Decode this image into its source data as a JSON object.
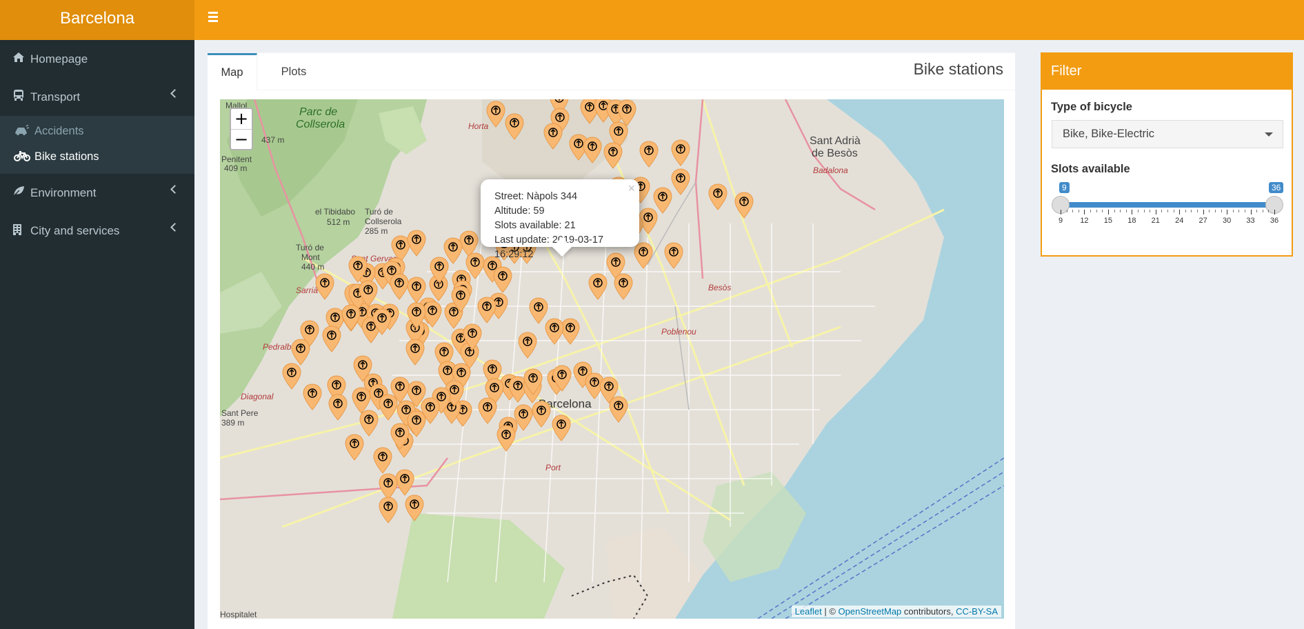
{
  "app": {
    "title": "Barcelona"
  },
  "sidebar": {
    "items": [
      {
        "label": "Homepage",
        "icon": "home-icon"
      },
      {
        "label": "Transport",
        "icon": "bus-icon"
      },
      {
        "label": "Environment",
        "icon": "leaf-icon"
      },
      {
        "label": "City and services",
        "icon": "building-icon"
      }
    ],
    "transport_sub": [
      {
        "label": "Accidents",
        "icon": "car-crash-icon"
      },
      {
        "label": "Bike stations",
        "icon": "bicycle-icon"
      }
    ]
  },
  "tabs": [
    {
      "label": "Map"
    },
    {
      "label": "Plots"
    }
  ],
  "box_title": "Bike stations",
  "map": {
    "zoom_in": "+",
    "zoom_out": "−",
    "labels": [
      {
        "text": "Parc de"
      },
      {
        "text": "Collserola"
      },
      {
        "text": "Horta"
      },
      {
        "text": "Sant Adrià"
      },
      {
        "text": "de Besòs"
      },
      {
        "text": "el Tibidabo"
      },
      {
        "text": "512 m"
      },
      {
        "text": "Turó de"
      },
      {
        "text": "Collserola"
      },
      {
        "text": "285 m"
      },
      {
        "text": "Turó de"
      },
      {
        "text": "Mont"
      },
      {
        "text": "440 m"
      },
      {
        "text": "Sant Gervasi"
      },
      {
        "text": "Sarrià"
      },
      {
        "text": "Pedralbes"
      },
      {
        "text": "Diagonal"
      },
      {
        "text": "Barcelona"
      },
      {
        "text": "Poblenou"
      },
      {
        "text": "Besòs"
      },
      {
        "text": "Port"
      },
      {
        "text": "Hospitalet"
      },
      {
        "text": "Mallol"
      },
      {
        "text": "Penitent"
      },
      {
        "text": "409 m"
      },
      {
        "text": "437 m"
      },
      {
        "text": "Sant Pere"
      },
      {
        "text": "389 m"
      },
      {
        "text": "Badalona"
      }
    ],
    "attribution": {
      "leaflet": "Leaflet",
      "sep": " | © ",
      "osm": "OpenStreetMap",
      "contrib": " contributors, ",
      "license": "CC-BY-SA"
    }
  },
  "popup": {
    "street": "Street: Nàpols 344",
    "altitude": "Altitude: 59",
    "slots": "Slots available: 21",
    "update": "Last update: 2019-03-17 16:29:12",
    "close": "×"
  },
  "filter": {
    "title": "Filter",
    "type_label": "Type of bicycle",
    "type_value": "Bike, Bike-Electric",
    "slots_label": "Slots available",
    "slider_min": 9,
    "slider_max": 36,
    "slider_from_label": "9",
    "slider_to_label": "36",
    "ticks": [
      "9",
      "12",
      "15",
      "18",
      "21",
      "24",
      "27",
      "30",
      "33",
      "36"
    ]
  },
  "colors": {
    "accent": "#f39c12",
    "sidebar": "#222d32",
    "slider": "#428bca",
    "pin": "#f8b872"
  }
}
